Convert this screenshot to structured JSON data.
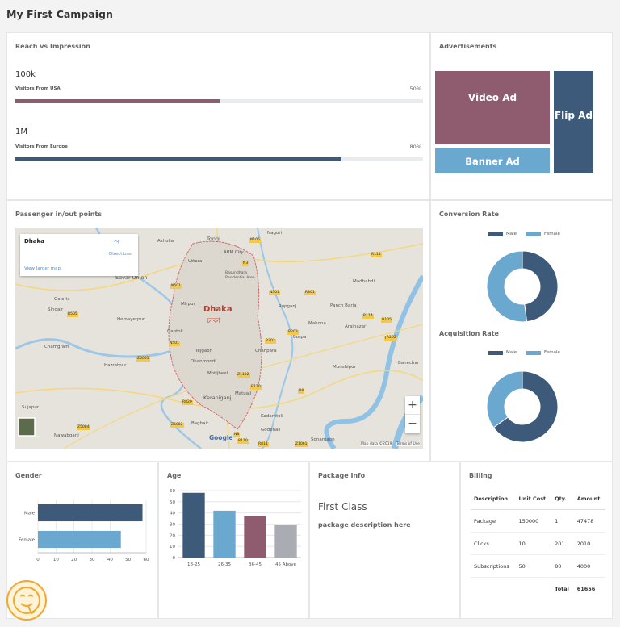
{
  "page": {
    "title": "My First Campaign"
  },
  "reach": {
    "title": "Reach vs Impression",
    "items": [
      {
        "value": "100k",
        "label": "Visitors From USA",
        "percent_text": "50%",
        "percent": 50,
        "color": "#8e5c6e"
      },
      {
        "value": "1M",
        "label": "Visitors From Europe",
        "percent_text": "80%",
        "percent": 80,
        "color": "#3d5a7a"
      }
    ]
  },
  "ads": {
    "title": "Advertisements",
    "tiles": [
      {
        "label": "Video Ad",
        "color": "#8e5c6e"
      },
      {
        "label": "Banner Ad",
        "color": "#6aa8d0"
      },
      {
        "label": "Flip Ad",
        "color": "#3d5a7a"
      }
    ]
  },
  "map": {
    "title": "Passenger in/out points",
    "place_name": "Dhaka",
    "directions": "Directions",
    "larger_map": "View larger map",
    "city_label": "Dhaka",
    "city_label_bn": "ঢাকা",
    "zoom_in": "+",
    "zoom_out": "−",
    "brand": "Google",
    "map_data": "Map data ©2019",
    "terms": "Terms of Use",
    "places": [
      "Ashulia",
      "Tongi",
      "ABM City",
      "Nagori",
      "Savar Union",
      "Uttara",
      "Basundhara Residential Area",
      "Goloria",
      "Singair",
      "Hemayetpur",
      "Mirpur",
      "Rupganj",
      "Panch Baria",
      "Madhabdi",
      "Gabtoli",
      "Mahona",
      "Araihazar",
      "Chamgram",
      "Tejgaon",
      "Dhanmondi",
      "Motijheel",
      "Chanpara",
      "Munshipur",
      "Hazratpur",
      "Keraniganj",
      "Matuail",
      "Borpa",
      "Kadamtoli",
      "Bahechar",
      "Sujapur",
      "Nawabganj",
      "Baghair",
      "Godenail",
      "Sonargaon"
    ],
    "roads": [
      "N105",
      "N3",
      "R114",
      "N301",
      "R301",
      "N501",
      "R505",
      "R202",
      "R203",
      "N501",
      "Z5061",
      "Z1102",
      "R110",
      "R820",
      "Z5082",
      "R250",
      "R114",
      "N105",
      "R202",
      "N8",
      "Z5084",
      "N8",
      "R811",
      "Z1061",
      "R110"
    ]
  },
  "conversion": {
    "title": "Conversion Rate",
    "legend": [
      "Male",
      "Female"
    ],
    "colors": [
      "#3d5a7a",
      "#6aa8d0"
    ],
    "values": [
      48,
      52
    ]
  },
  "acquisition": {
    "title": "Acquisition Rate",
    "legend": [
      "Male",
      "Female"
    ],
    "colors": [
      "#3d5a7a",
      "#6aa8d0"
    ],
    "values": [
      65,
      35
    ]
  },
  "gender": {
    "title": "Gender",
    "chart_data": {
      "type": "bar",
      "orientation": "horizontal",
      "categories": [
        "Male",
        "Female"
      ],
      "values": [
        58,
        46
      ],
      "colors": [
        "#3d5a7a",
        "#6aa8d0"
      ],
      "xlim": [
        0,
        60
      ],
      "xticks": [
        "0",
        "10",
        "20",
        "30",
        "40",
        "50",
        "60"
      ],
      "grid": true
    }
  },
  "age": {
    "title": "Age",
    "chart_data": {
      "type": "bar",
      "categories": [
        "18-25",
        "26-35",
        "36-45",
        "45 Above"
      ],
      "values": [
        58,
        42,
        37,
        29
      ],
      "colors": [
        "#3d5a7a",
        "#6aa8d0",
        "#8e5c6e",
        "#a9adb3"
      ],
      "ylim": [
        0,
        60
      ],
      "yticks": [
        "0",
        "10",
        "20",
        "30",
        "40",
        "50",
        "60"
      ],
      "grid": true
    }
  },
  "package": {
    "title": "Package Info",
    "name": "First Class",
    "description": "package description here"
  },
  "billing": {
    "title": "Billing",
    "headers": [
      "Description",
      "Unit Cost",
      "Qty.",
      "Amount"
    ],
    "rows": [
      [
        "Package",
        "150000",
        "1",
        "47478"
      ],
      [
        "Clicks",
        "10",
        "201",
        "2010"
      ],
      [
        "Subscriptions",
        "50",
        "80",
        "4000"
      ]
    ],
    "total_label": "Total",
    "total_value": "61656"
  }
}
